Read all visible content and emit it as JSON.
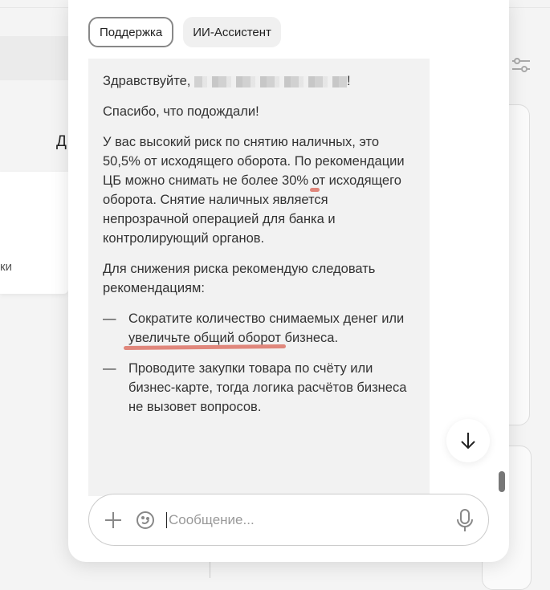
{
  "background": {
    "letter": "Д",
    "card_text": "ки"
  },
  "tabs": [
    {
      "label": "Поддержка",
      "active": true
    },
    {
      "label": "ИИ-Ассистент",
      "active": false
    }
  ],
  "message": {
    "greeting": "Здравствуйте,",
    "greeting_end": "!",
    "thanks": "Спасибо, что подождали!",
    "risk_before": "У вас высокий риск по снятию наличных, это 50,5% от исходящего оборота. По ",
    "risk_underlined": "рекомендации ЦБ",
    "risk_after": " можно снимать не более 30% от исходящего оборота. Снятие наличных является непрозрачной операцией для банка и контролирующий органов.",
    "advice_intro": "Для снижения риска рекомендую следовать рекомендациям:",
    "list": [
      {
        "before": "Сократите количество снимаемых денег или ",
        "underlined": "увеличьте общий оборот",
        "after": " бизнеса."
      },
      {
        "before": "Проводите закупки товара по счёту или бизнес-карте, тогда логика расчётов бизнеса не вызовет вопросов.",
        "underlined": "",
        "after": ""
      }
    ],
    "dash": "—"
  },
  "composer": {
    "placeholder": "Сообщение...",
    "value": ""
  },
  "colors": {
    "underline": "#e0877c",
    "bubble": "#f2f2f2"
  }
}
